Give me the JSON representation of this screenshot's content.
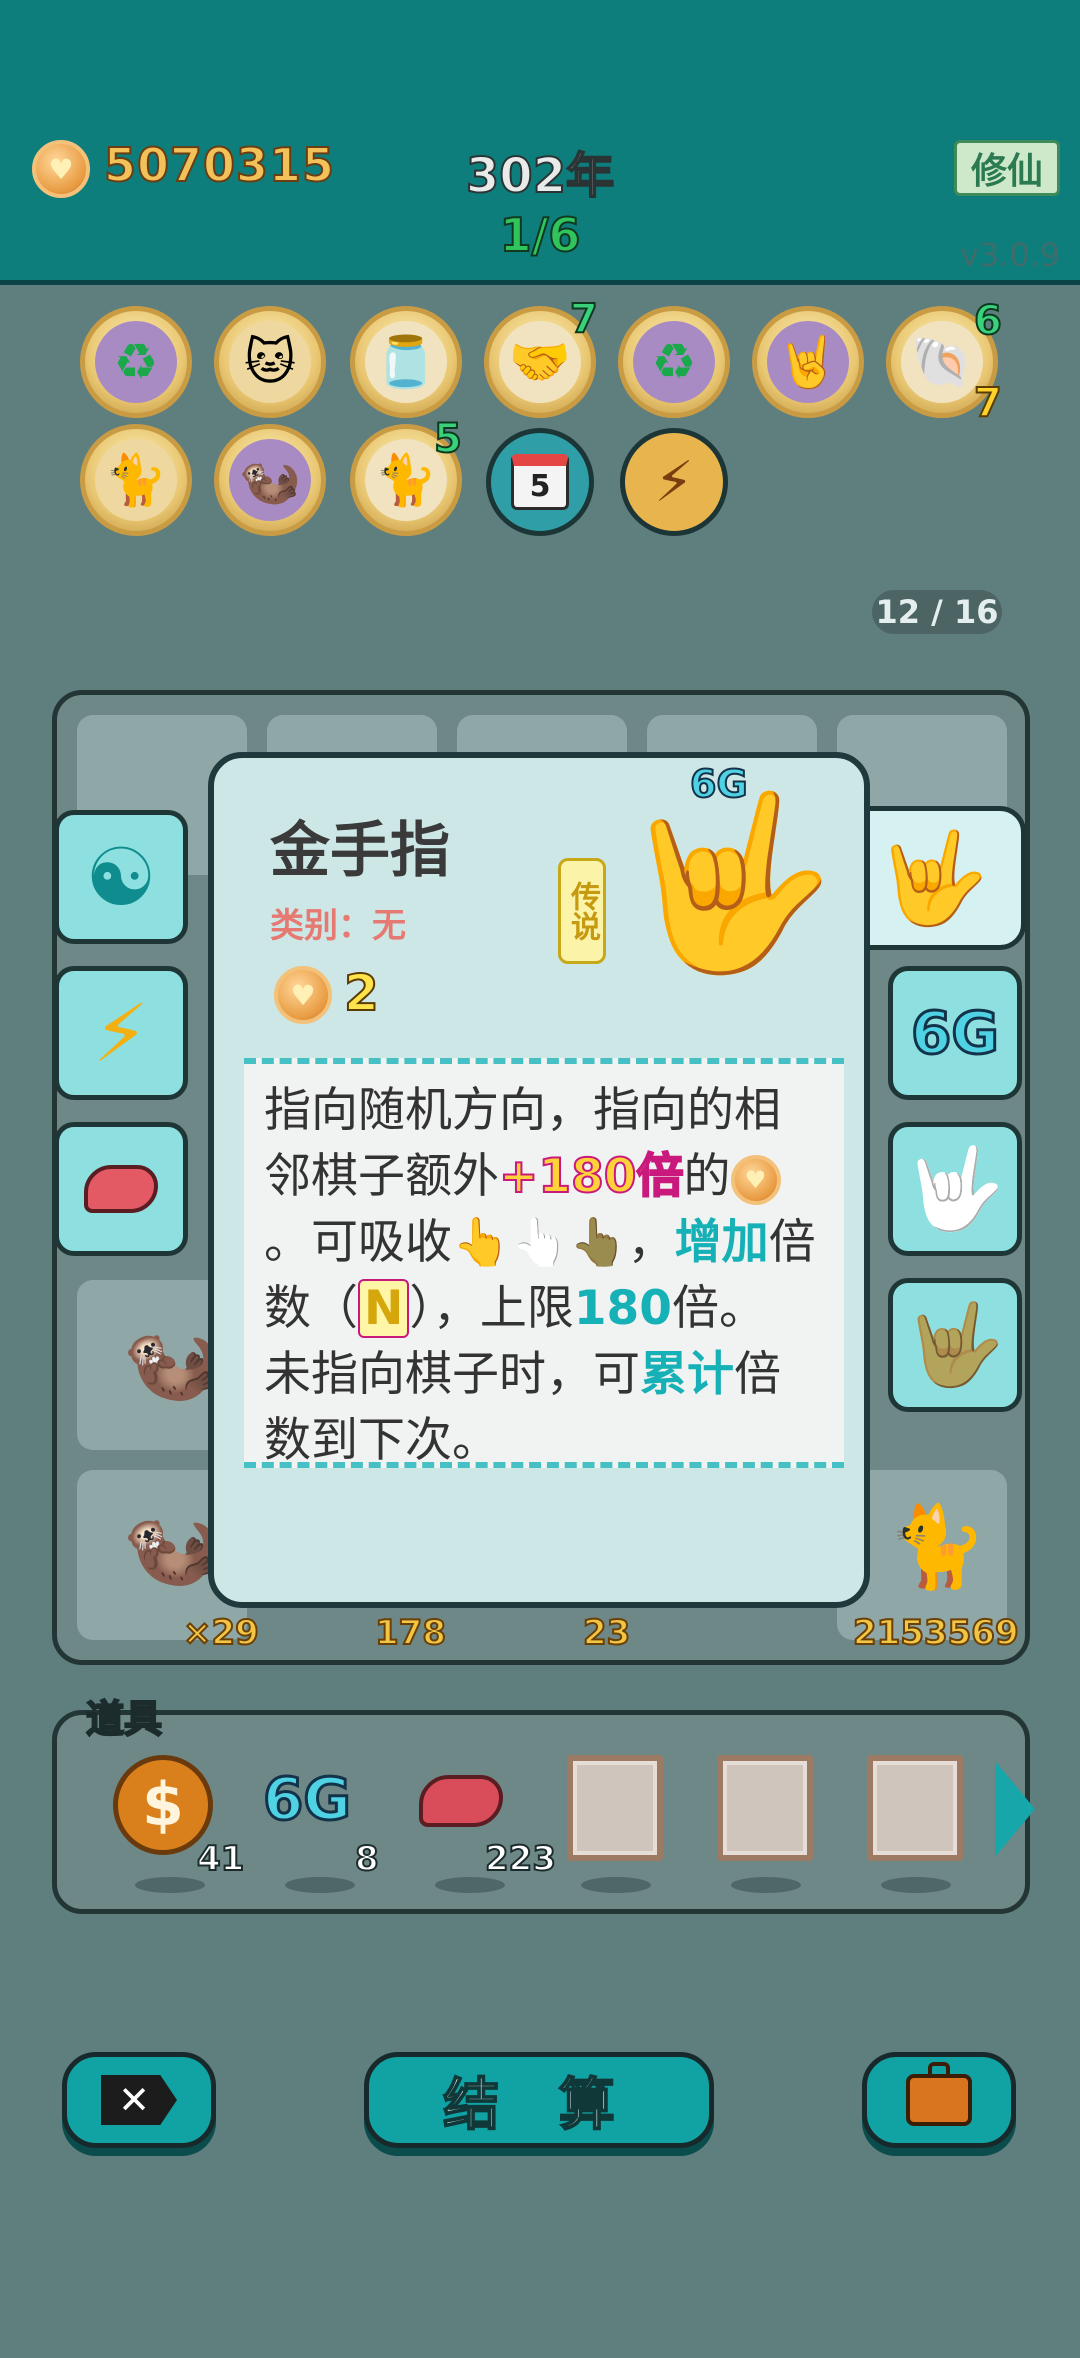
{
  "header": {
    "money": "5070315",
    "year": "302年",
    "round": "1/6",
    "cultivate_button": "修仙",
    "version": "v3.0.9"
  },
  "relics": [
    {
      "icon": "recycle-icon",
      "glyph": "♻",
      "purple": true
    },
    {
      "icon": "cats-icon",
      "glyph": "🐱",
      "purple": false
    },
    {
      "icon": "jar-icon",
      "glyph": "🫙",
      "purple": false
    },
    {
      "icon": "handshake-icon",
      "glyph": "🤝",
      "count": "7",
      "purple": false
    },
    {
      "icon": "recycle-icon",
      "glyph": "♻",
      "purple": true
    },
    {
      "icon": "rock-hand-icon",
      "glyph": "🤘",
      "purple": true
    },
    {
      "icon": "shell-icon",
      "glyph": "🐚",
      "count_top": "6",
      "count_bottom": "7",
      "purple": false
    },
    {
      "icon": "cats-pair-icon",
      "glyph": "🐈",
      "purple": false
    },
    {
      "icon": "meerkats-icon",
      "glyph": "🦦",
      "purple": true
    },
    {
      "icon": "cat-icon",
      "glyph": "🐈",
      "count": "5",
      "purple": false
    },
    {
      "icon": "calendar-icon",
      "glyph": "5"
    },
    {
      "icon": "lightning-icon",
      "glyph": "⚡"
    }
  ],
  "board": {
    "counter": "12 / 16",
    "bottom_numbers": [
      "×29",
      "178",
      "23",
      "2153569"
    ]
  },
  "popup": {
    "title": "金手指",
    "category": "类别：无",
    "rarity": "传说",
    "value": "2",
    "corner_label": "6G",
    "desc": {
      "l1": "指向随机方向，指向的相",
      "l2a": "邻棋子额外",
      "l2b": "+180倍",
      "l2c": "的",
      "l3a": "。可吸收",
      "l3b": "，",
      "l3c": "增加",
      "l3d": "倍",
      "l4a": "数（",
      "l4b": "N",
      "l4c": "），上限",
      "l4d": "180",
      "l4e": "倍。",
      "l5a": "未指向棋子时，可",
      "l5b": "累计",
      "l5c": "倍",
      "l6": "数到下次。"
    }
  },
  "side_left": [
    "yin-yang-icon",
    "lightning-icon",
    "liver-icon"
  ],
  "side_right": [
    "yellow-hand-icon",
    "6G",
    "white-hand-icon",
    "brown-hand-icon"
  ],
  "items": {
    "label": "道具",
    "list": [
      {
        "icon": "dollar-coin-icon",
        "count": "41"
      },
      {
        "icon": "6g-icon",
        "text": "6G",
        "count": "8"
      },
      {
        "icon": "liver-icon",
        "count": "223"
      }
    ]
  },
  "bottom": {
    "settle": "结 算"
  },
  "colors": {
    "header_bg": "#0d7e7c",
    "overlay_bg": "#5f7e7e",
    "accent_teal": "#11a3a3",
    "gold": "#f3c15a"
  }
}
